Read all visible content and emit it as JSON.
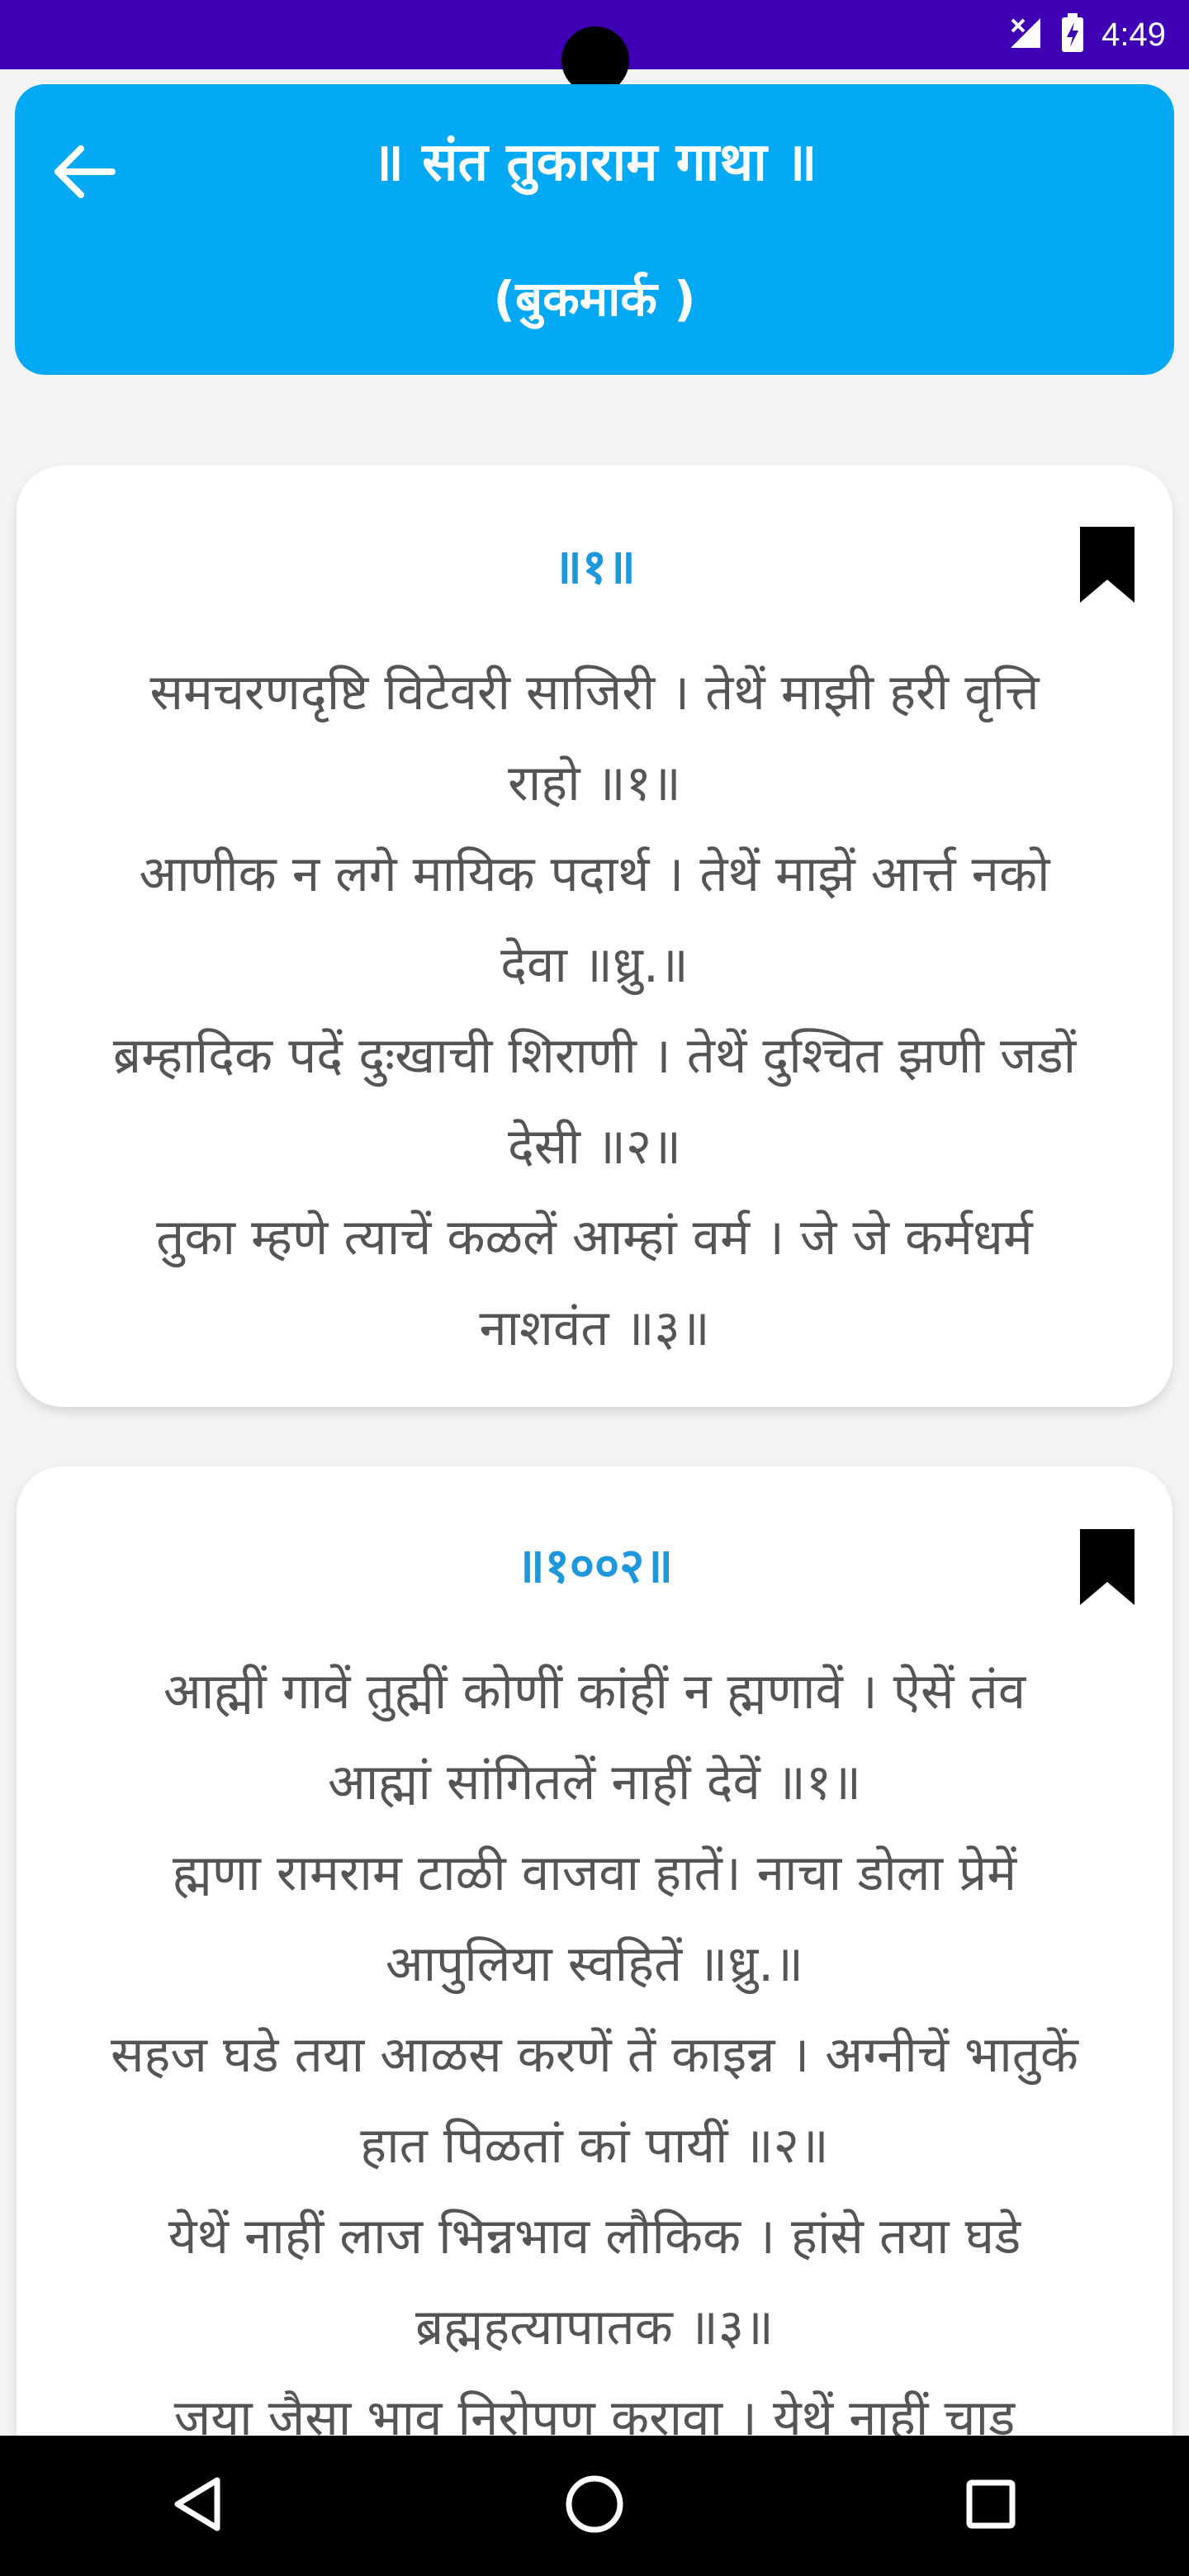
{
  "status_bar": {
    "time": "4:49"
  },
  "header": {
    "title": "॥ संत तुकाराम गाथा ॥",
    "subtitle": "(बुकमार्क )"
  },
  "cards": [
    {
      "number": "॥१॥",
      "lines": [
        "समचरणदृष्टि विटेवरी साजिरी । तेथें माझी हरी वृत्ति",
        "राहो ॥१॥",
        "आणीक न लगे मायिक पदार्थ । तेथें माझें आर्त्त नको",
        "देवा ॥ध्रु.॥",
        "ब्रम्हादिक पदें दुःखाची शिराणी । तेथें दुश्चित झणी जडों",
        "देसी ॥२॥",
        "तुका म्हणे त्याचें कळलें आम्हां वर्म । जे जे कर्मधर्म",
        "नाशवंत ॥३॥"
      ]
    },
    {
      "number": "॥१००२॥",
      "lines": [
        "आह्मीं गावें तुह्मीं कोणीं कांहीं न ह्मणावें । ऐसें तंव",
        "आह्मां सांगितलें नाहीं देवें ॥१॥",
        "ह्मणा रामराम टाळी वाजवा हातें। नाचा डोला प्रेमें",
        "आपुलिया स्वहितें ॥ध्रु.॥",
        "सहज घडे तया आळस करणें तें काइन्न । अग्नीचें भातुकें",
        "हात पिळतां कां पायीं ॥२॥",
        "येथें नाहीं लाज भिन्नभाव लौकिक । हांसे तया घडे",
        "ब्रह्महत्यापातक ॥३॥",
        "जया जैसा भाव निरोपण करावा । येथें नाहीं चाड"
      ]
    }
  ],
  "colors": {
    "status_bar": "#3f00b5",
    "header": "#03a9f4",
    "number_accent": "#1e98dc",
    "verse_text": "#555555"
  },
  "icons": {
    "back": "arrow-left-icon",
    "bookmark": "bookmark-icon",
    "nav_back": "triangle-back-icon",
    "nav_home": "circle-home-icon",
    "nav_recents": "square-recents-icon"
  }
}
